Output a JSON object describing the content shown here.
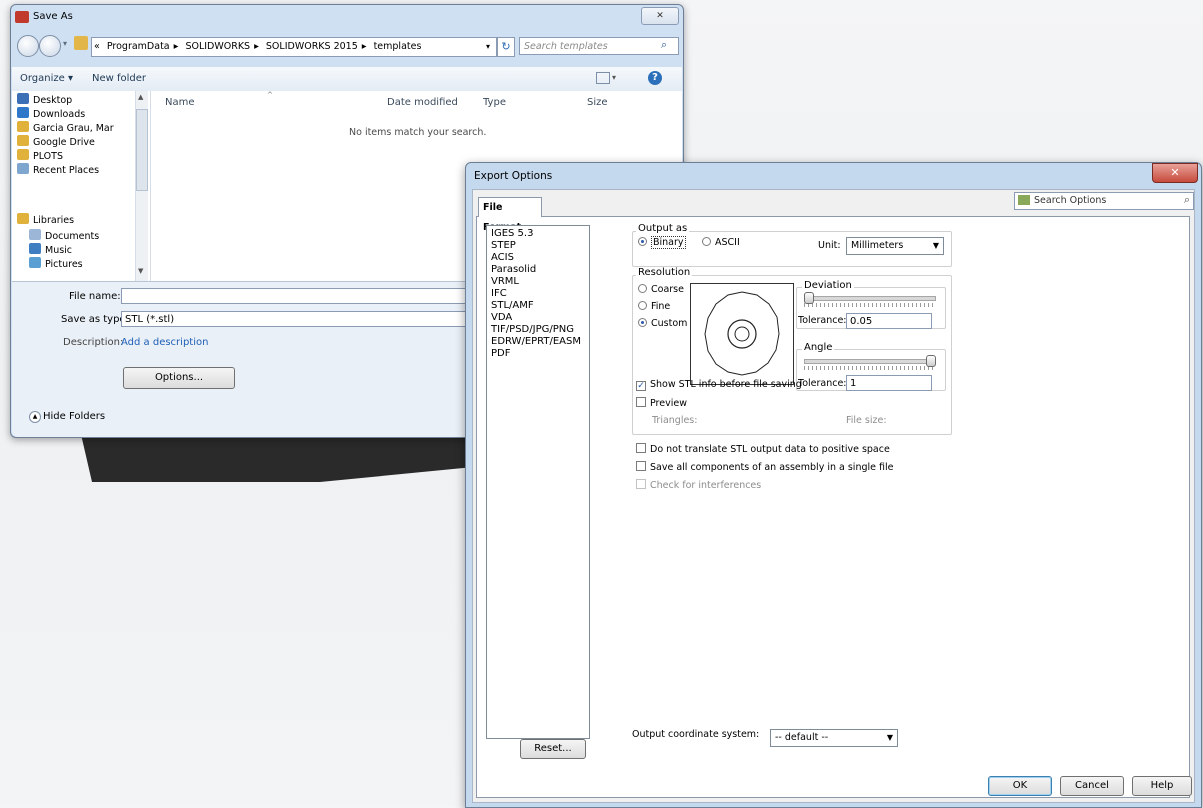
{
  "save_as": {
    "title": "Save As",
    "close_glyph": "✕",
    "breadcrumb": [
      "«",
      "ProgramData",
      "SOLIDWORKS",
      "SOLIDWORKS 2015",
      "templates"
    ],
    "search_placeholder": "Search templates",
    "toolbar": {
      "organize": "Organize ▾",
      "new_folder": "New folder"
    },
    "nav_items": [
      {
        "label": "Desktop",
        "icon": "desktop-icon",
        "color": "#3b6fb6"
      },
      {
        "label": "Downloads",
        "icon": "downloads-icon",
        "color": "#2f78c9"
      },
      {
        "label": "Garcia Grau, Mar",
        "icon": "user-folder-icon",
        "color": "#e0b23c"
      },
      {
        "label": "Google Drive",
        "icon": "google-drive-icon",
        "color": "#e0b23c"
      },
      {
        "label": "PLOTS",
        "icon": "folder-icon",
        "color": "#e0b23c"
      },
      {
        "label": "Recent Places",
        "icon": "recent-places-icon",
        "color": "#7fa6cf"
      },
      {
        "label": "Libraries",
        "icon": "libraries-icon",
        "color": "#e0b23c"
      },
      {
        "label": "Documents",
        "icon": "documents-icon",
        "color": "#9bb6d6"
      },
      {
        "label": "Music",
        "icon": "music-icon",
        "color": "#3f7fc1"
      },
      {
        "label": "Pictures",
        "icon": "pictures-icon",
        "color": "#5a9fd4"
      }
    ],
    "columns": [
      "Name",
      "Date modified",
      "Type",
      "Size"
    ],
    "empty_message": "No items match your search.",
    "file_name_label": "File name:",
    "file_name_value": "",
    "save_as_type_label": "Save as type:",
    "save_as_type_value": "STL (*.stl)",
    "description_label": "Description:",
    "description_link": "Add a description",
    "options_button": "Options...",
    "hide_folders": "Hide Folders"
  },
  "export": {
    "title": "Export Options",
    "close_glyph": "✕",
    "tab_label": "File Format",
    "search_placeholder": "Search Options",
    "formats": [
      "IGES 5.3",
      "STEP",
      "ACIS",
      "Parasolid",
      "VRML",
      "IFC",
      "STL/AMF",
      "VDA",
      "TIF/PSD/JPG/PNG",
      "EDRW/EPRT/EASM",
      "PDF"
    ],
    "output_as_label": "Output as",
    "binary_label": "Binary",
    "ascii_label": "ASCII",
    "unit_label": "Unit:",
    "unit_value": "Millimeters",
    "resolution_label": "Resolution",
    "coarse_label": "Coarse",
    "fine_label": "Fine",
    "custom_label": "Custom",
    "deviation_label": "Deviation",
    "deviation_tolerance_label": "Tolerance:",
    "deviation_tolerance_value": "0.05",
    "angle_label": "Angle",
    "angle_tolerance_label": "Tolerance:",
    "angle_tolerance_value": "1",
    "show_stl_info": "Show STL info before file saving",
    "preview_label": "Preview",
    "triangles_label": "Triangles:",
    "file_size_label": "File size:",
    "no_translate": "Do not translate STL output data to positive space",
    "save_all_components": "Save all components of an assembly in a single file",
    "check_interferences": "Check for interferences",
    "coord_system_label": "Output coordinate system:",
    "coord_system_value": "-- default --",
    "reset_button": "Reset...",
    "ok_button": "OK",
    "cancel_button": "Cancel",
    "help_button": "Help",
    "deviation_level": 0.0,
    "angle_level": 1.0
  }
}
